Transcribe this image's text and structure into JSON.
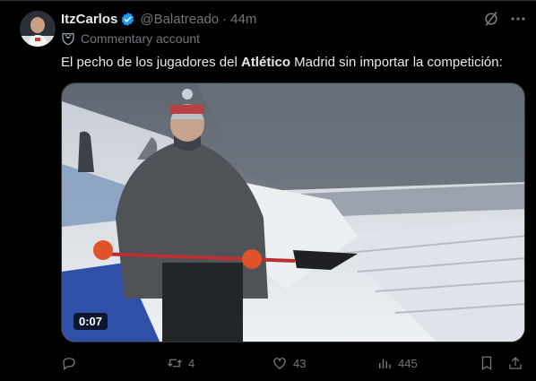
{
  "post": {
    "author_name": "ItzCarlos",
    "handle": "@Balatreado",
    "separator": "·",
    "time": "44m",
    "account_label": "Commentary account",
    "text_before": "El pecho de los jugadores del ",
    "text_bold": "Atlético",
    "text_after": " Madrid sin importar la competición:",
    "video_duration": "0:07"
  },
  "actions": {
    "reply_count": "",
    "repost_count": "4",
    "like_count": "43",
    "view_count": "445"
  },
  "colors": {
    "background": "#000000",
    "text": "#e7e9ea",
    "muted": "#71767b",
    "verified": "#1d9bf0"
  },
  "icons": [
    "verified-badge-icon",
    "grok-icon",
    "more-icon",
    "commentary-icon",
    "reply-icon",
    "repost-icon",
    "like-icon",
    "views-icon",
    "bookmark-icon",
    "share-icon"
  ]
}
